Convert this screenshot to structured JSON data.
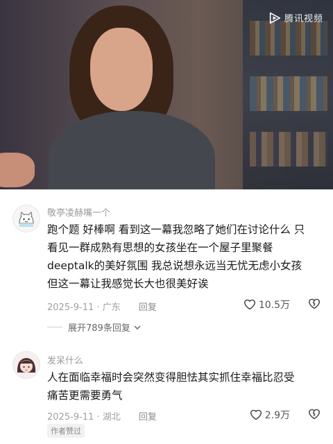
{
  "video": {
    "watermark_text": "腾讯视频",
    "watermark_icon": "tencent-video-play-icon"
  },
  "comments": [
    {
      "username": "敬亭凌赫嘴一个",
      "text_lines": [
        "跑个题 好棒啊 看到这一幕我忽略了她们在讨论什么 只",
        "看见一群成熟有思想的女孩坐在一个屋子里聚餐",
        "deeptalk的美好氛围 我总说想永远当无忧无虑小女孩",
        "但这一幕让我感觉长大也很美好诶"
      ],
      "date": "2025-9-11",
      "location": "广东",
      "reply_label": "回复",
      "likes": "10.5万",
      "expand_label": "展开789条回复"
    },
    {
      "username": "发呆什么",
      "text_lines": [
        "人在面临幸福时会突然变得胆怯其实抓住幸福比忍受",
        "痛苦更需要勇气"
      ],
      "date": "2025-9-11",
      "location": "湖北",
      "reply_label": "回复",
      "likes": "2.9万",
      "badge": "作者赞过"
    }
  ],
  "colors": {
    "text": "#1a1a1a",
    "secondary": "#9a9a9a"
  }
}
